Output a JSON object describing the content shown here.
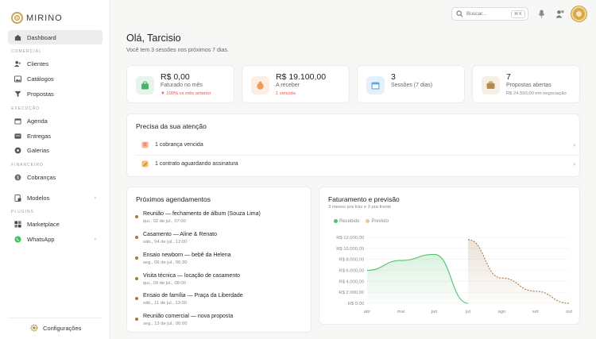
{
  "brand": {
    "name": "MIRINO"
  },
  "sidebar": {
    "dashboard": "Dashboard",
    "sec_comercial": "COMERCIAL",
    "clientes": "Clientes",
    "catalogos": "Catálogos",
    "propostas": "Propostas",
    "sec_execucao": "EXECUÇÃO",
    "agenda": "Agenda",
    "entregas": "Entregas",
    "galerias": "Galerias",
    "sec_financeiro": "FINANCEIRO",
    "cobrancas": "Cobranças",
    "modelos": "Modelos",
    "sec_plugins": "PLUGINS",
    "marketplace": "Marketplace",
    "whatsapp": "WhatsApp",
    "configuracoes": "Configurações"
  },
  "header": {
    "search_placeholder": "Buscar...",
    "shortcut": "⌘ K"
  },
  "main": {
    "greeting": "Olá, Tarcisio",
    "subtitle": "Você tem 3 sessões nos próximos 7 dias."
  },
  "stats": [
    {
      "value": "R$ 0,00",
      "label": "Faturado no mês",
      "sub": "▼ 100% vs mês anterior",
      "sub_color": "#e0584f",
      "icon_bg": "#e6f5ea",
      "icon_color": "#4caf6e"
    },
    {
      "value": "R$ 19.100,00",
      "label": "A receber",
      "sub": "1 vencida",
      "sub_color": "#e0584f",
      "icon_bg": "#fdeee3",
      "icon_color": "#ee9a5a"
    },
    {
      "value": "3",
      "label": "Sessões (7 dias)",
      "sub": "",
      "sub_color": "#888",
      "icon_bg": "#e4f1fa",
      "icon_color": "#5aa7dc"
    },
    {
      "value": "7",
      "label": "Propostas abertas",
      "sub": "R$ 24.550,00 em negociação",
      "sub_color": "#888",
      "icon_bg": "#f6efe4",
      "icon_color": "#b58a4a"
    }
  ],
  "attention": {
    "title": "Precisa da sua atenção",
    "items": [
      {
        "label": "1 cobrança vencida",
        "icon": "invoice-alert-icon"
      },
      {
        "label": "1 contrato aguardando assinatura",
        "icon": "contract-pen-icon"
      }
    ]
  },
  "appointments": {
    "title": "Próximos agendamentos",
    "items": [
      {
        "title": "Reunião — fechamento de álbum (Souza Lima)",
        "date": "qui., 02 de jul., 07:00"
      },
      {
        "title": "Casamento — Aline & Renato",
        "date": "sáb., 04 de jul., 12:00"
      },
      {
        "title": "Ensaio newborn — bebê da Helena",
        "date": "seg., 06 de jul., 06:30"
      },
      {
        "title": "Visita técnica — locação de casamento",
        "date": "qui., 09 de jul., 08:00"
      },
      {
        "title": "Ensaio de família — Praça da Liberdade",
        "date": "sáb., 11 de jul., 13:00"
      },
      {
        "title": "Reunião comercial — nova proposta",
        "date": "seg., 13 de jul., 06:00"
      }
    ]
  },
  "revenue": {
    "title": "Faturamento e previsão",
    "subtitle": "3 meses pra trás e 3 pra frente",
    "legend_received": "Recebido",
    "legend_forecast": "Previsto"
  },
  "chart_data": {
    "type": "area",
    "categories": [
      "abr",
      "mai",
      "jun",
      "jul",
      "ago",
      "set",
      "out"
    ],
    "y_ticks": [
      "R$ 0,00",
      "R$ 2.000,00",
      "R$ 4.000,00",
      "R$ 6.000,00",
      "R$ 8.000,00",
      "R$ 10.000,00",
      "R$ 12.000,00"
    ],
    "ylim": [
      0,
      12000
    ],
    "series": [
      {
        "name": "Recebido",
        "color": "#55bf6f",
        "values": [
          6000,
          7800,
          8900,
          0,
          null,
          null,
          null
        ]
      },
      {
        "name": "Previsto",
        "color": "#a57b4b",
        "values": [
          null,
          null,
          null,
          11600,
          4600,
          2200,
          0
        ]
      }
    ]
  }
}
